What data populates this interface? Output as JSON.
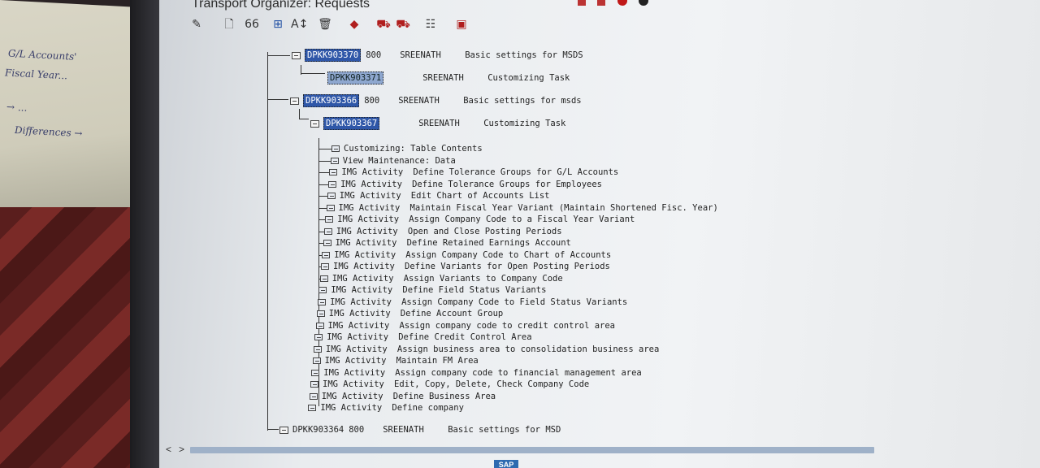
{
  "window": {
    "title": "Transport Organizer: Requests"
  },
  "toolbar": {
    "buttons": [
      {
        "name": "display-change-icon",
        "glyph": "✎"
      },
      {
        "name": "create-icon",
        "glyph": "🗋"
      },
      {
        "name": "find-icon",
        "glyph": "66"
      },
      {
        "name": "hierarchy-icon",
        "glyph": "⊞"
      },
      {
        "name": "sort-icon",
        "glyph": "A↕"
      },
      {
        "name": "delete-icon",
        "glyph": "🗑"
      },
      {
        "name": "release-icon",
        "glyph": "◆"
      },
      {
        "name": "transport-icon",
        "glyph": "⛟"
      },
      {
        "name": "transport-red-icon",
        "glyph": "⛟"
      },
      {
        "name": "log-icon",
        "glyph": "☷"
      },
      {
        "name": "info-icon",
        "glyph": "▣"
      }
    ]
  },
  "tree": {
    "requests": [
      {
        "id": "DPKK903370",
        "client": "800",
        "owner": "SREENATH",
        "desc": "Basic settings for MSDS"
      },
      {
        "id": "DPKK903371",
        "client": "",
        "owner": "SREENATH",
        "desc": "Customizing Task"
      },
      {
        "id": "DPKK903366",
        "client": "800",
        "owner": "SREENATH",
        "desc": "Basic settings for msds"
      },
      {
        "id": "DPKK903367",
        "client": "",
        "owner": "SREENATH",
        "desc": "Customizing Task"
      },
      {
        "id": "DPKK903364",
        "client": "800",
        "owner": "SREENATH",
        "desc": "Basic settings for MSD"
      }
    ],
    "objects": [
      {
        "type": "Customizing: Table Contents",
        "desc": ""
      },
      {
        "type": "View Maintenance: Data",
        "desc": ""
      },
      {
        "type": "IMG Activity",
        "desc": "Define Tolerance Groups for G/L Accounts"
      },
      {
        "type": "IMG Activity",
        "desc": "Define Tolerance Groups for Employees"
      },
      {
        "type": "IMG Activity",
        "desc": "Edit Chart of Accounts List"
      },
      {
        "type": "IMG Activity",
        "desc": "Maintain Fiscal Year Variant (Maintain Shortened Fisc. Year)"
      },
      {
        "type": "IMG Activity",
        "desc": "Assign Company Code to a Fiscal Year Variant"
      },
      {
        "type": "IMG Activity",
        "desc": "Open and Close Posting Periods"
      },
      {
        "type": "IMG Activity",
        "desc": "Define Retained Earnings Account"
      },
      {
        "type": "IMG Activity",
        "desc": "Assign Company Code to Chart of Accounts"
      },
      {
        "type": "IMG Activity",
        "desc": "Define Variants for Open Posting Periods"
      },
      {
        "type": "IMG Activity",
        "desc": "Assign Variants to Company Code"
      },
      {
        "type": "IMG Activity",
        "desc": "Define Field Status Variants"
      },
      {
        "type": "IMG Activity",
        "desc": "Assign Company Code to Field Status Variants"
      },
      {
        "type": "IMG Activity",
        "desc": "Define Account Group"
      },
      {
        "type": "IMG Activity",
        "desc": "Assign company code to credit control area"
      },
      {
        "type": "IMG Activity",
        "desc": "Define Credit Control Area"
      },
      {
        "type": "IMG Activity",
        "desc": "Assign business area to consolidation business area"
      },
      {
        "type": "IMG Activity",
        "desc": "Maintain FM Area"
      },
      {
        "type": "IMG Activity",
        "desc": "Assign company code to financial management area"
      },
      {
        "type": "IMG Activity",
        "desc": "Edit, Copy, Delete, Check Company Code"
      },
      {
        "type": "IMG Activity",
        "desc": "Define Business Area"
      },
      {
        "type": "IMG Activity",
        "desc": "Define company"
      }
    ]
  },
  "scroll": {
    "left": "<",
    "right": ">"
  },
  "brand": "SAP",
  "notebook": {
    "lines": [
      "G/L Accounts'",
      "Fiscal Year...",
      "→ ...",
      "Differences →"
    ]
  }
}
